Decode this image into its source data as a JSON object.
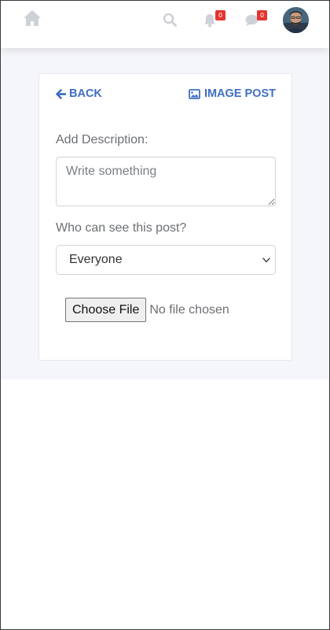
{
  "nav": {
    "icons": [
      "home-icon",
      "search-icon",
      "bell-icon",
      "chat-icon"
    ],
    "notifications_count": "0",
    "messages_count": "0",
    "muted_icon_color": "#cfd1d9",
    "badge_color": "#e3342f"
  },
  "card": {
    "back_label": "BACK",
    "title": "IMAGE POST",
    "accent_color": "#3f6fc2"
  },
  "form": {
    "description_label": "Add Description:",
    "description_placeholder": "Write something",
    "description_value": "",
    "visibility_label": "Who can see this post?",
    "visibility_selected": "Everyone",
    "file_button_label": "Choose File",
    "file_status": "No file chosen"
  }
}
